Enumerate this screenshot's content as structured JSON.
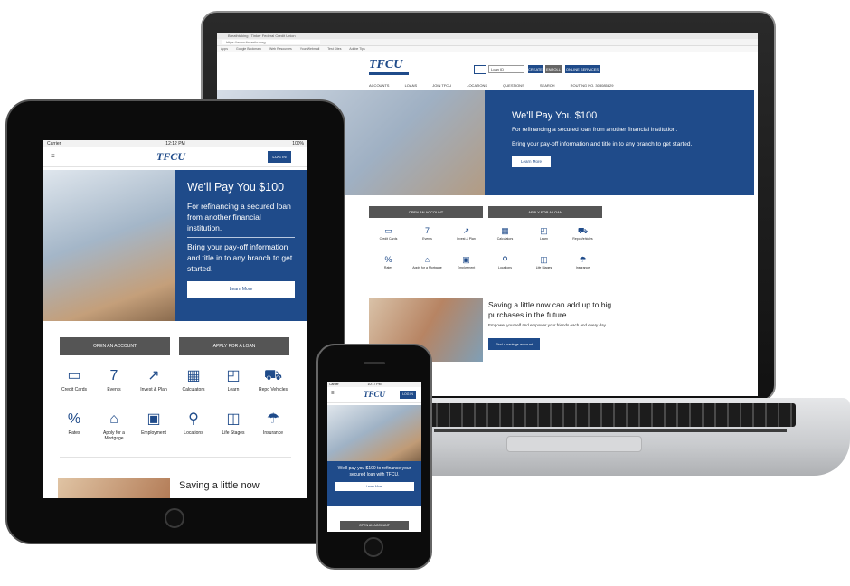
{
  "brand": {
    "logo": "TFCU",
    "primary_color": "#1f4b8a",
    "cta_gray": "#555555"
  },
  "laptop": {
    "browser": {
      "tab_label": "Breathtaking | Tinker Federal Credit Union",
      "address": "https://www.tinkerfcu.org",
      "bookmarks": [
        "Apps",
        "Google Bookmark",
        "Web Resources",
        "Your Webmail",
        "Test Sites",
        "Adobe Tips"
      ]
    },
    "header": {
      "search_value": "Loan ID",
      "buttons": [
        "CREATE",
        "ENROLL",
        "ONLINE SERVICES"
      ]
    },
    "nav": [
      "ACCOUNTS",
      "LOANS",
      "JOIN TFCU",
      "LOCATIONS",
      "QUESTIONS",
      "SEARCH",
      "ROUTING NO. 303085829"
    ],
    "hero": {
      "title": "We'll Pay You $100",
      "line1": "For refinancing a secured loan from another financial institution.",
      "line2": "Bring your pay-off information and title in to any branch to get started.",
      "button": "Learn More"
    },
    "ctas": [
      "OPEN AN ACCOUNT",
      "APPLY FOR A LOAN"
    ],
    "icons": [
      {
        "label": "Credit Cards",
        "glyph": "▭"
      },
      {
        "label": "Events",
        "glyph": "7"
      },
      {
        "label": "Invest & Plan",
        "glyph": "↗"
      },
      {
        "label": "Calculators",
        "glyph": "▦"
      },
      {
        "label": "Learn",
        "glyph": "◰"
      },
      {
        "label": "Repo Vehicles",
        "glyph": "⛟"
      },
      {
        "label": "Rates",
        "glyph": "%"
      },
      {
        "label": "Apply for a Mortgage",
        "glyph": "⌂"
      },
      {
        "label": "Employment",
        "glyph": "▣"
      },
      {
        "label": "Locations",
        "glyph": "⚲"
      },
      {
        "label": "Life Stages",
        "glyph": "◫"
      },
      {
        "label": "Insurance",
        "glyph": "☂"
      }
    ],
    "savings": {
      "title": "Saving a little now can add up to big purchases in the future",
      "body": "Empower yourself and empower your friends each and every day.",
      "button": "Find a savings account"
    }
  },
  "tablet": {
    "status": {
      "carrier": "Carrier",
      "time": "12:12 PM",
      "battery": "100%"
    },
    "login": "LOG IN",
    "hero": {
      "title": "We'll Pay You $100",
      "line1": "For refinancing a secured loan from another financial institution.",
      "line2": "Bring your pay-off information and title in to any branch to get started.",
      "button": "Learn More"
    },
    "ctas": [
      "OPEN AN ACCOUNT",
      "APPLY FOR A LOAN"
    ],
    "icons": [
      {
        "label": "Credit Cards",
        "glyph": "▭"
      },
      {
        "label": "Events",
        "glyph": "7"
      },
      {
        "label": "Invest & Plan",
        "glyph": "↗"
      },
      {
        "label": "Calculators",
        "glyph": "▦"
      },
      {
        "label": "Learn",
        "glyph": "◰"
      },
      {
        "label": "Repo Vehicles",
        "glyph": "⛟"
      },
      {
        "label": "Rates",
        "glyph": "%"
      },
      {
        "label": "Apply for a Mortgage",
        "glyph": "⌂"
      },
      {
        "label": "Employment",
        "glyph": "▣"
      },
      {
        "label": "Locations",
        "glyph": "⚲"
      },
      {
        "label": "Life Stages",
        "glyph": "◫"
      },
      {
        "label": "Insurance",
        "glyph": "☂"
      }
    ],
    "savings_title": "Saving a little now"
  },
  "phone": {
    "status": {
      "carrier": "Carrier",
      "time": "10:17 PM"
    },
    "login": "LOG IN",
    "hero_text": "We'll pay you $100 to refinance your secured loan with TFCU.",
    "button": "Learn More",
    "cta": "OPEN AN ACCOUNT"
  }
}
